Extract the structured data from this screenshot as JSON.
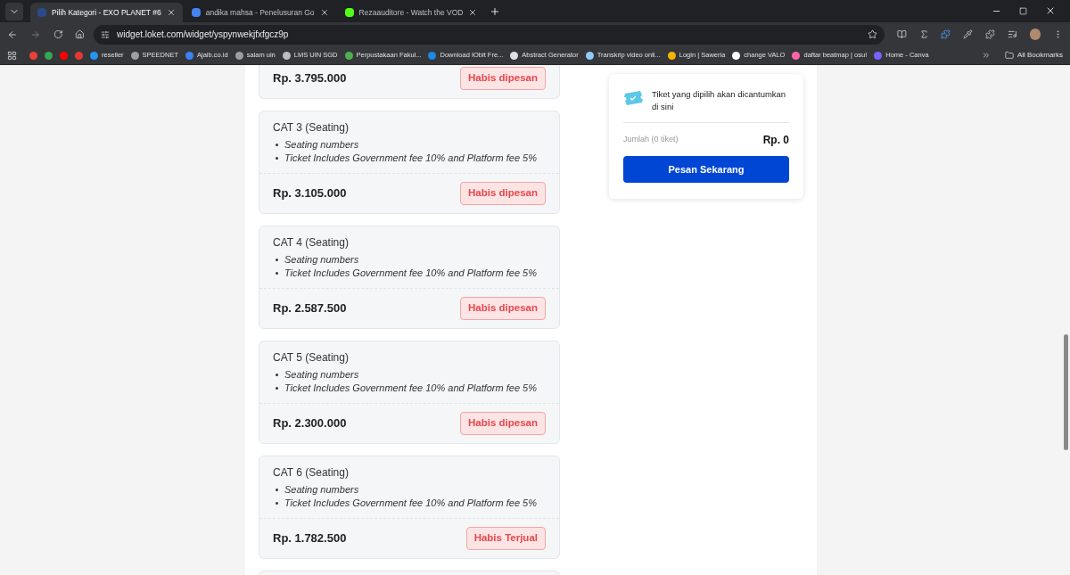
{
  "tabs": [
    {
      "title": "Pilih Kategori - EXO PLANET #6",
      "selected": true,
      "color": "#2b4a8a"
    },
    {
      "title": "andika mahsa - Penelusuran Go",
      "selected": false,
      "color": "#4285f4"
    },
    {
      "title": "Rezaauditore - Watch the VOD",
      "selected": false,
      "color": "#53fc18"
    }
  ],
  "address": {
    "url": "widget.loket.com/widget/yspynwekjfxfgcz9p"
  },
  "bookmarks": [
    {
      "color": "#ea4335"
    },
    {
      "color": "#34a853"
    },
    {
      "color": "#ff0000"
    },
    {
      "color": "#e53935"
    },
    {
      "label": "reseller",
      "color": "#2196f3"
    },
    {
      "label": "SPEEDNET",
      "color": "#9e9e9e"
    },
    {
      "label": "Ajaib.co.id",
      "color": "#3b82f6"
    },
    {
      "label": "salam uin",
      "color": "#9e9e9e"
    },
    {
      "label": "LMS UIN SGD",
      "color": "#bdbdbd"
    },
    {
      "label": "Perpustakaan Fakul...",
      "color": "#4caf50"
    },
    {
      "label": "Download IObit Fre...",
      "color": "#1e88e5"
    },
    {
      "label": "Abstract Generator",
      "color": "#e0e0e0"
    },
    {
      "label": "Transkrip video onli...",
      "color": "#90caf9"
    },
    {
      "label": "Login | Saweria",
      "color": "#f4b400"
    },
    {
      "label": "change VALO",
      "color": "#ffffff"
    },
    {
      "label": "daftar beatmap | osu!",
      "color": "#ff66aa"
    },
    {
      "label": "Home - Canva",
      "color": "#7b61ff"
    }
  ],
  "all_bookmarks": "All Bookmarks",
  "tickets": [
    {
      "price": "Rp. 3.795.000",
      "status": "Habis dipesan"
    },
    {
      "name": "CAT 3 (Seating)",
      "features": [
        "Seating numbers",
        "Ticket Includes Government fee 10% and Platform fee 5%"
      ],
      "price": "Rp. 3.105.000",
      "status": "Habis dipesan"
    },
    {
      "name": "CAT 4 (Seating)",
      "features": [
        "Seating numbers",
        "Ticket Includes Government fee 10% and Platform fee 5%"
      ],
      "price": "Rp. 2.587.500",
      "status": "Habis dipesan"
    },
    {
      "name": "CAT 5 (Seating)",
      "features": [
        "Seating numbers",
        "Ticket Includes Government fee 10% and Platform fee 5%"
      ],
      "price": "Rp. 2.300.000",
      "status": "Habis dipesan"
    },
    {
      "name": "CAT 6 (Seating)",
      "features": [
        "Seating numbers",
        "Ticket Includes Government fee 10% and Platform fee 5%"
      ],
      "price": "Rp. 1.782.500",
      "status": "Habis Terjual"
    }
  ],
  "summary": {
    "message": "Tiket yang dipilih akan dicantumkan di sini",
    "count_label": "Jumlah (0 tiket)",
    "total": "Rp. 0",
    "button": "Pesan Sekarang"
  }
}
